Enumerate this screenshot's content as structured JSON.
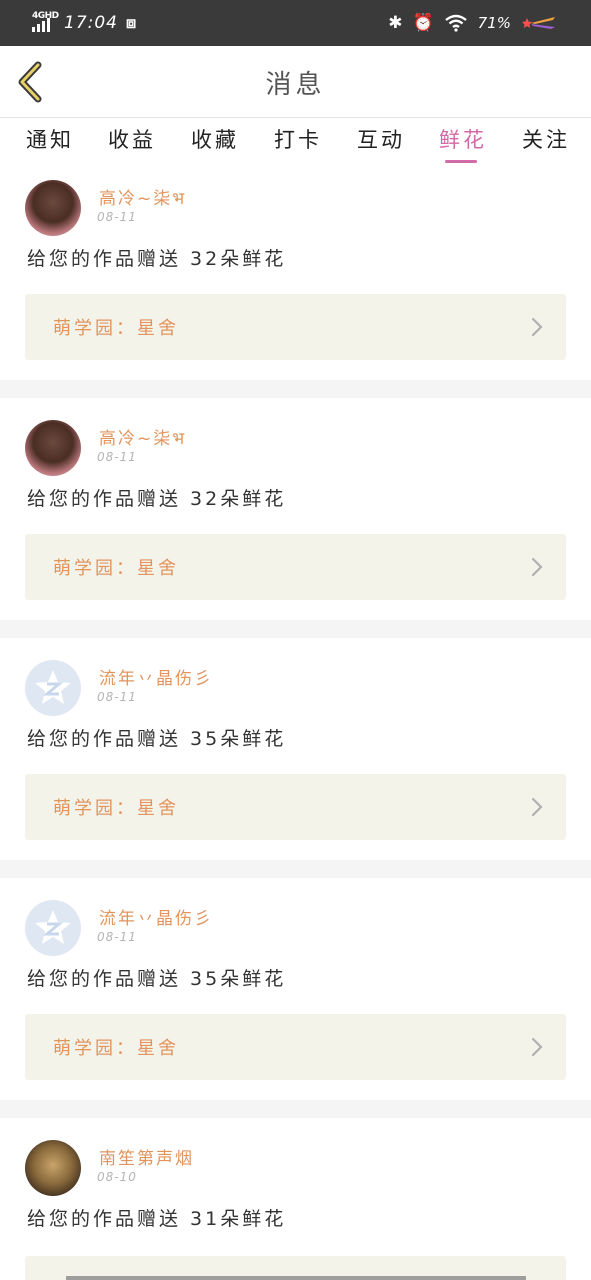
{
  "status_bar": {
    "network": "4GHD",
    "time": "17:04",
    "battery": "71%"
  },
  "header": {
    "title": "消息"
  },
  "tabs": [
    {
      "label": "通知",
      "active": false
    },
    {
      "label": "收益",
      "active": false
    },
    {
      "label": "收藏",
      "active": false
    },
    {
      "label": "打卡",
      "active": false
    },
    {
      "label": "互动",
      "active": false
    },
    {
      "label": "鲜花",
      "active": true
    },
    {
      "label": "关注",
      "active": false
    }
  ],
  "colors": {
    "accent": "#d36aa8",
    "username": "#e3945d",
    "card_box": "#f3f3ea"
  },
  "messages": [
    {
      "username": "高冷~柒भ",
      "date": "08-11",
      "text": "给您的作品赠送 32朵鲜花",
      "work": "萌学园：星舍",
      "avatar": "photo-avatar"
    },
    {
      "username": "高冷~柒भ",
      "date": "08-11",
      "text": "给您的作品赠送 32朵鲜花",
      "work": "萌学园：星舍",
      "avatar": "photo-avatar"
    },
    {
      "username": "流年丷晶伤彡",
      "date": "08-11",
      "text": "给您的作品赠送 35朵鲜花",
      "work": "萌学园：星舍",
      "avatar": "qq-avatar"
    },
    {
      "username": "流年丷晶伤彡",
      "date": "08-11",
      "text": "给您的作品赠送 35朵鲜花",
      "work": "萌学园：星舍",
      "avatar": "qq-avatar"
    },
    {
      "username": "南笙第声烟",
      "date": "08-10",
      "text": "给您的作品赠送 31朵鲜花",
      "work": "",
      "avatar": "photo-avatar"
    }
  ]
}
